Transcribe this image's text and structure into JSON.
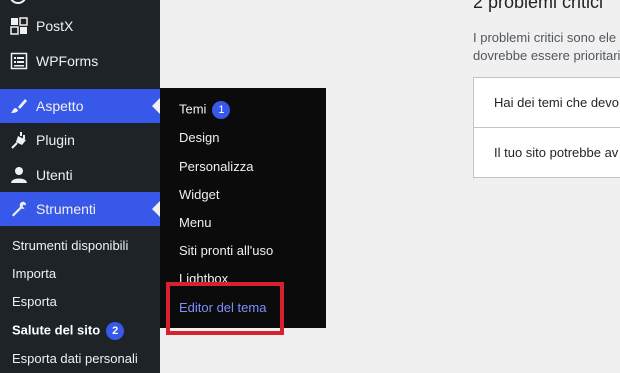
{
  "sidebar": {
    "items": [
      {
        "label": "PostX",
        "icon": "postx-icon"
      },
      {
        "label": "WPForms",
        "icon": "wpforms-icon"
      },
      {
        "label": "Aspetto",
        "icon": "paintbrush-icon"
      },
      {
        "label": "Plugin",
        "icon": "plug-icon"
      },
      {
        "label": "Utenti",
        "icon": "user-icon"
      },
      {
        "label": "Strumenti",
        "icon": "wrench-icon"
      }
    ],
    "submenu": [
      {
        "label": "Strumenti disponibili"
      },
      {
        "label": "Importa"
      },
      {
        "label": "Esporta"
      },
      {
        "label": "Salute del sito",
        "badge": "2"
      },
      {
        "label": "Esporta dati personali"
      }
    ]
  },
  "flyout": {
    "items": [
      {
        "label": "Temi",
        "badge": "1"
      },
      {
        "label": "Design"
      },
      {
        "label": "Personalizza"
      },
      {
        "label": "Widget"
      },
      {
        "label": "Menu"
      },
      {
        "label": "Siti pronti all'uso"
      },
      {
        "label": "Lightbox"
      },
      {
        "label": "Editor del tema"
      }
    ]
  },
  "main": {
    "heading": "2 problemi critici",
    "description_line1": "I problemi critici sono ele",
    "description_line2": "dovrebbe essere prioritari",
    "issues": [
      {
        "label": "Hai dei temi che devo"
      },
      {
        "label": "Il tuo sito potrebbe av"
      }
    ]
  },
  "colors": {
    "sidebar_bg": "#1d2327",
    "active_bg": "#3858e9",
    "flyout_bg": "#0b0b0b",
    "highlight_text": "#7b90ff",
    "annotation_red": "#d8212f"
  }
}
